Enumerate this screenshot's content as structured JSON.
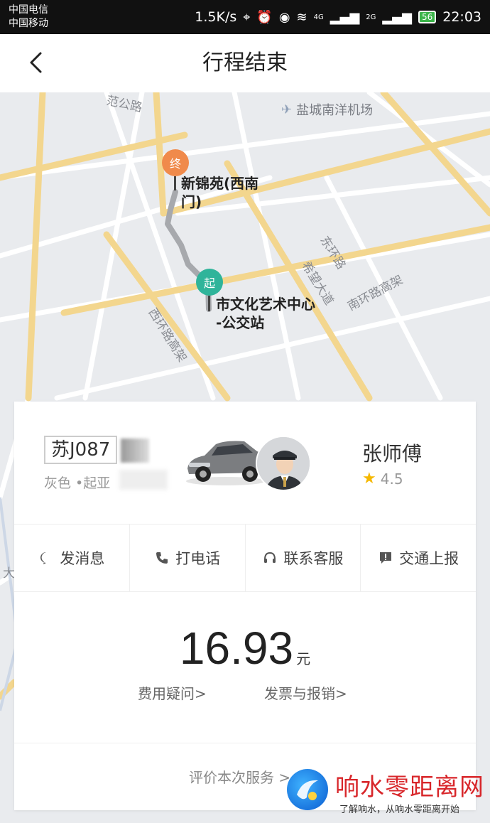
{
  "status_bar": {
    "carrier1": "中国电信",
    "carrier2": "中国移动",
    "speed": "1.5K/s",
    "network1": "4G",
    "network2": "2G",
    "battery": "56",
    "time": "22:03"
  },
  "nav": {
    "title": "行程结束"
  },
  "map": {
    "airport_label": "盐城南洋机场",
    "end_pin": "终",
    "start_pin": "起",
    "end_place_line1": "新锦苑(西南",
    "end_place_line2": "门)",
    "start_place_line1": "市文化艺术中心",
    "start_place_line2": "-公交站",
    "roads": {
      "top_left": "范公路",
      "east_ring": "东环路",
      "xiwang": "希望大道",
      "south_ring": "南环路高架",
      "west_ring": "西环路高架",
      "left_edge": "大"
    },
    "colors": {
      "end_pin": "#f08a4b",
      "start_pin": "#2fb49a",
      "route": "#a7a9ad",
      "major_road": "#f3d68e"
    }
  },
  "driver": {
    "plate": "苏J087",
    "car_info": "灰色 •起亚",
    "name": "张师傅",
    "rating": "4.5"
  },
  "actions": [
    {
      "label": "发消息",
      "icon": "message-icon"
    },
    {
      "label": "打电话",
      "icon": "phone-icon"
    },
    {
      "label": "联系客服",
      "icon": "headset-icon"
    },
    {
      "label": "交通上报",
      "icon": "report-icon"
    }
  ],
  "fare": {
    "amount": "16.93",
    "unit": "元",
    "question_link": "费用疑问>",
    "invoice_link": "发票与报销>"
  },
  "rate": {
    "label": "评价本次服务 >"
  },
  "watermark": {
    "title": "响水零距离网",
    "subtitle": "了解响水，从响水零距离开始"
  }
}
